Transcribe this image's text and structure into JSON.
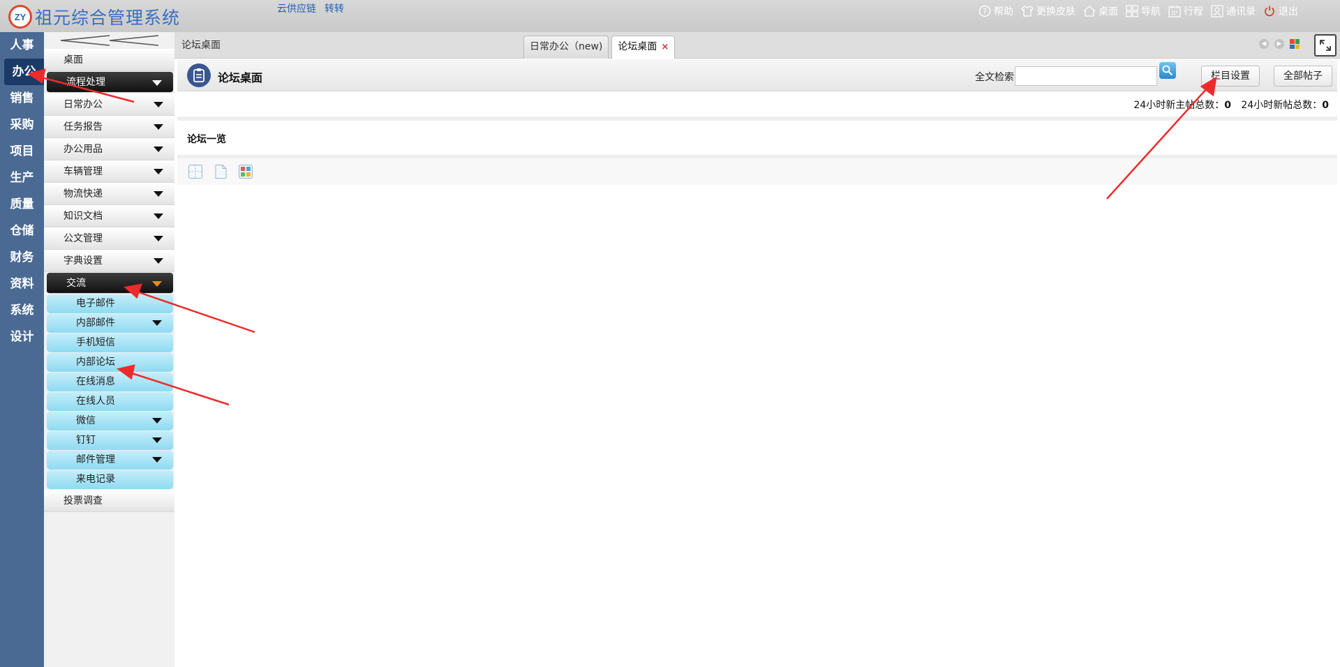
{
  "app": {
    "title": "祖元综合管理系统",
    "logo_text": "ZY",
    "top_links": [
      "云供应链",
      "转转"
    ],
    "top_actions": [
      {
        "label": "帮助",
        "icon": "help-icon"
      },
      {
        "label": "更换皮肤",
        "icon": "shirt-icon"
      },
      {
        "label": "桌面",
        "icon": "home-icon"
      },
      {
        "label": "导航",
        "icon": "grid-icon"
      },
      {
        "label": "行程",
        "icon": "calendar-icon"
      },
      {
        "label": "通讯录",
        "icon": "contacts-icon"
      },
      {
        "label": "退出",
        "icon": "power-icon"
      }
    ]
  },
  "rail": {
    "items": [
      "人事",
      "办公",
      "销售",
      "采购",
      "项目",
      "生产",
      "质量",
      "仓储",
      "财务",
      "资料",
      "系统",
      "设计"
    ],
    "active": "办公"
  },
  "sidebar": {
    "top_item": "桌面",
    "items": [
      {
        "label": "流程处理"
      },
      {
        "label": "日常办公"
      },
      {
        "label": "任务报告"
      },
      {
        "label": "办公用品"
      },
      {
        "label": "车辆管理"
      },
      {
        "label": "物流快递"
      },
      {
        "label": "知识文档"
      },
      {
        "label": "公文管理"
      },
      {
        "label": "字典设置"
      }
    ],
    "open_group": "交流",
    "sub_items": [
      {
        "label": "电子邮件"
      },
      {
        "label": "内部邮件"
      },
      {
        "label": "手机短信"
      },
      {
        "label": "内部论坛"
      },
      {
        "label": "在线消息"
      },
      {
        "label": "在线人员"
      },
      {
        "label": "微信"
      },
      {
        "label": "钉钉"
      },
      {
        "label": "邮件管理"
      },
      {
        "label": "来电记录"
      }
    ],
    "bottom_item": "投票调查"
  },
  "tabbar": {
    "breadcrumb": "论坛桌面",
    "tabs": [
      {
        "label": "日常办公（new)"
      },
      {
        "label": "论坛桌面"
      }
    ],
    "close_glyph": "×"
  },
  "page": {
    "title": "论坛桌面",
    "search_label": "全文检索",
    "search_value": "",
    "buttons": [
      "栏目设置",
      "全部帖子"
    ],
    "stats": [
      {
        "label": "24小时新主帖总数：",
        "value": "0"
      },
      {
        "label": "24小时新帖总数：",
        "value": "0"
      }
    ],
    "section_title": "论坛一览"
  },
  "colors": {
    "rail_bg": "#4a6a94",
    "rail_active": "#1c3a67",
    "submenu_bg": "#8fdaf2",
    "annotation_arrow": "#ee2a2a",
    "title_blue": "#3a6ec0"
  }
}
